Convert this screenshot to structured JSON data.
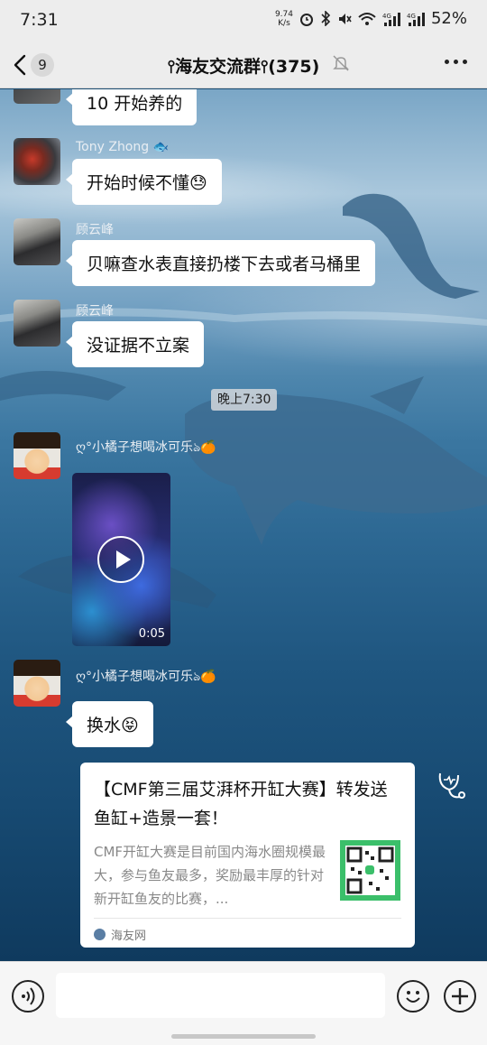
{
  "status_bar": {
    "time": "7:31",
    "net_speed_value": "9.74",
    "net_speed_unit": "K/s",
    "battery": "52%"
  },
  "header": {
    "back_badge": "9",
    "title": "⫯海友交流群⫯(375)"
  },
  "messages": {
    "m1": {
      "text": "10 开始养的"
    },
    "m2": {
      "name": "Tony Zhong 🐟",
      "text": "开始时候不懂😓"
    },
    "m3": {
      "name": "顾云峰",
      "text": "贝嘛查水表直接扔楼下去或者马桶里"
    },
    "m4": {
      "name": "顾云峰",
      "text": "没证据不立案"
    },
    "time_divider": "晚上7:30",
    "m5": {
      "name": "ღ°小橘子想喝冰可乐ঌ🍊",
      "video_duration": "0:05"
    },
    "m6": {
      "name": "ღ°小橘子想喝冰可乐ঌ🍊",
      "text": "换水😝"
    },
    "card": {
      "title": "【CMF第三届艾湃杯开缸大赛】转发送鱼缸+造景一套！",
      "description": "CMF开缸大赛是目前国内海水圈规模最大，参与鱼友最多，奖励最丰厚的针对新开缸鱼友的比赛，...",
      "source": "海友网"
    }
  },
  "colors": {
    "header_bg": "#ededed",
    "bubble_bg": "#ffffff",
    "qr_green": "#3bbf6a"
  },
  "icons": [
    "back-arrow-icon",
    "mute-bell-icon",
    "more-icon",
    "play-icon",
    "forward-icon",
    "voice-icon",
    "emoji-icon",
    "plus-icon"
  ]
}
